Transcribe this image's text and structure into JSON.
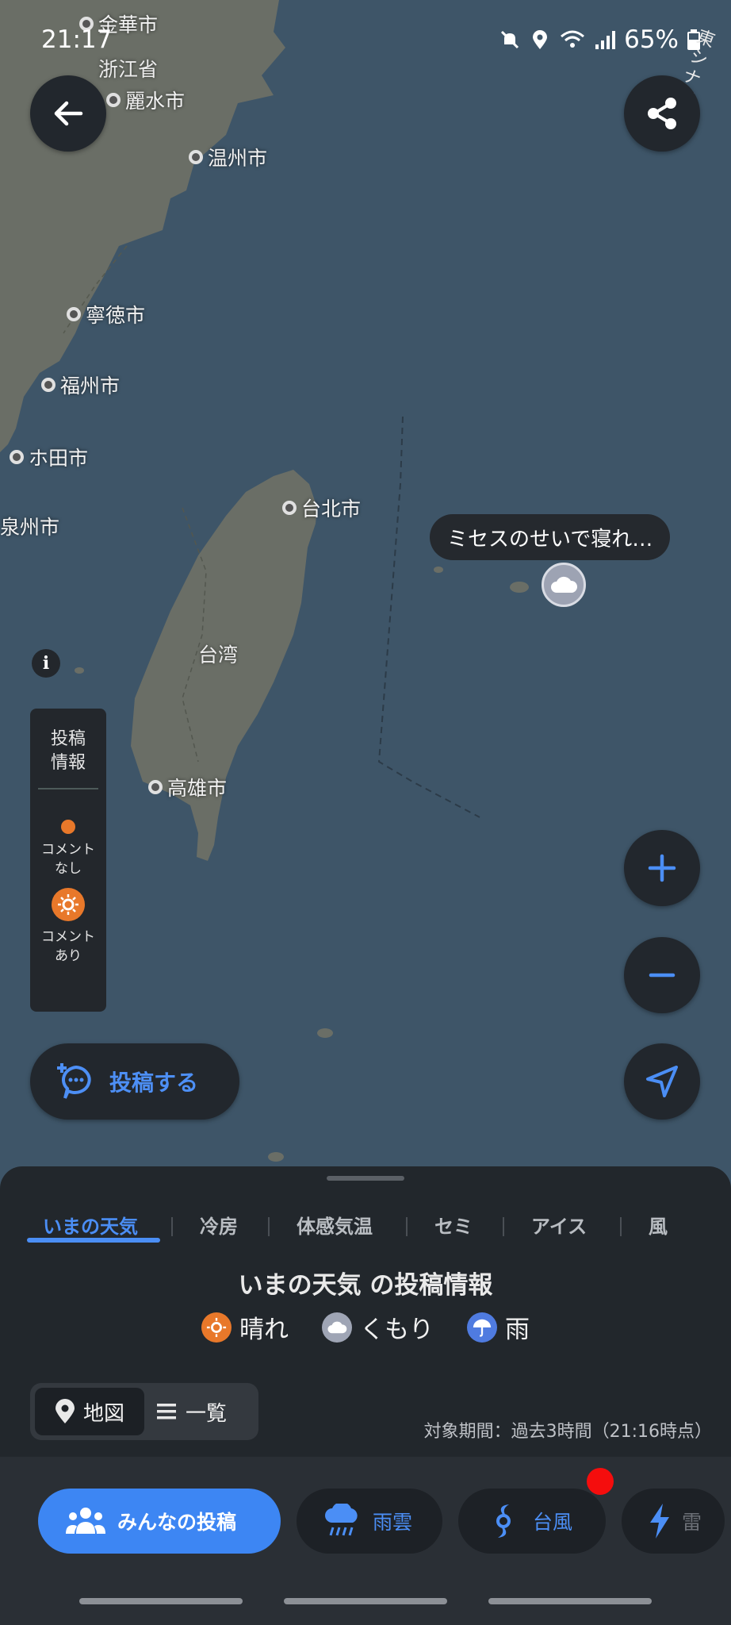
{
  "status_bar": {
    "time": "21:17",
    "battery": "65%",
    "icons": [
      "mute-icon",
      "location-icon",
      "wifi-icon",
      "signal-icon",
      "battery-icon"
    ]
  },
  "map": {
    "cities": [
      {
        "name": "金華市"
      },
      {
        "name": "麗水市"
      },
      {
        "name": "温州市"
      },
      {
        "name": "寧徳市"
      },
      {
        "name": "福州市"
      },
      {
        "name": "ホ田市"
      },
      {
        "name": "泉州市"
      },
      {
        "name": "台北市"
      },
      {
        "name": "高雄市"
      }
    ],
    "regions": {
      "zhejiang": "浙江省",
      "taiwan": "台湾",
      "east_china_sea": "東シナ海"
    },
    "bubble_text": "ミセスのせいで寝れ…"
  },
  "legend": {
    "title": "投稿\n情報",
    "no_comment": "コメント\nなし",
    "with_comment": "コメント\nあり"
  },
  "post_button": {
    "label": "投稿する"
  },
  "sheet": {
    "tabs": [
      "いまの天気",
      "冷房",
      "体感気温",
      "セミ",
      "アイス",
      "風"
    ],
    "title": "いまの天気 の投稿情報",
    "weather_legend": [
      {
        "label": "晴れ",
        "icon": "sun-icon",
        "color": "#e8782a"
      },
      {
        "label": "くもり",
        "icon": "cloud-icon",
        "color": "#9fa5b5"
      },
      {
        "label": "雨",
        "icon": "rain-icon",
        "color": "#4f7be0"
      }
    ],
    "view_map": "地図",
    "view_list": "一覧",
    "period": "対象期間：過去3時間（21:16時点）"
  },
  "bottom_nav": {
    "everyone": "みんなの投稿",
    "rain_cloud": "雨雲",
    "typhoon": "台風",
    "thunder": "雷"
  },
  "colors": {
    "accent": "#3d86f3",
    "sun": "#e8782a",
    "map_sea": "#3e5568",
    "map_land": "#6a6e66"
  }
}
